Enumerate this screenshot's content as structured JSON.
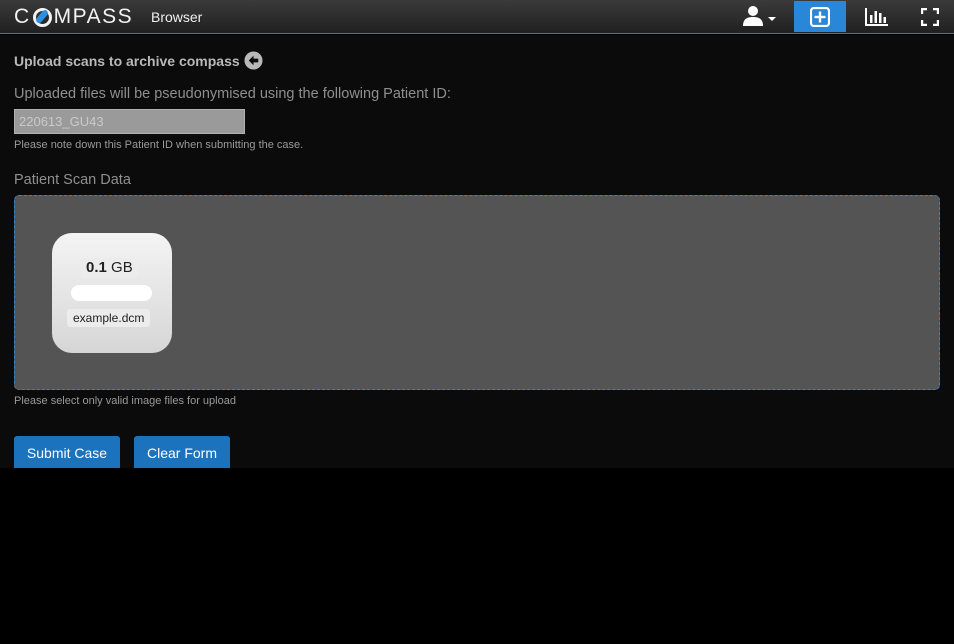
{
  "navbar": {
    "logo_left": "C",
    "logo_right": "MPASS",
    "browser_link": "Browser",
    "icons": {
      "user": "user-icon",
      "add": "plus-square-icon",
      "stats": "bar-chart-icon",
      "fullscreen": "fullscreen-icon"
    },
    "accent_color": "#2a86d6"
  },
  "upload": {
    "title": "Upload scans to archive compass",
    "pseudonym_label": "Uploaded files will be pseudonymised using the following Patient ID:",
    "patient_id": "220613_GU43",
    "patient_note": "Please note down this Patient ID when submitting the case.",
    "scan_label": "Patient Scan Data",
    "file": {
      "size_value": "0.1",
      "size_unit": "GB",
      "name": "example.dcm",
      "progress": 1.0
    },
    "hint": "Please select only valid image files for upload"
  },
  "actions": {
    "submit": "Submit Case",
    "clear": "Clear Form"
  }
}
